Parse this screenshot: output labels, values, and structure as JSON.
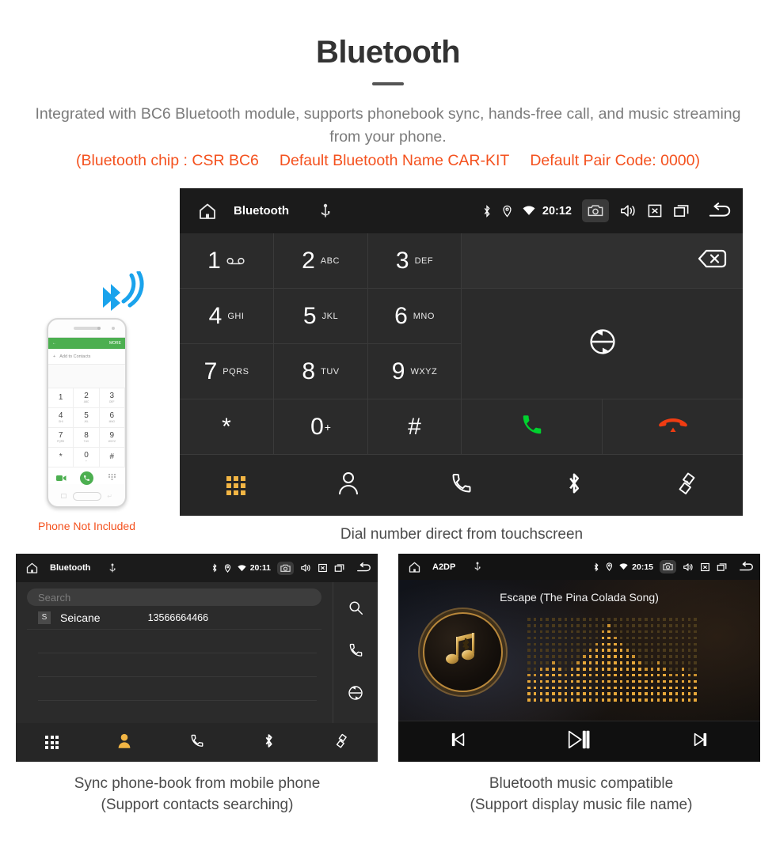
{
  "header": {
    "title": "Bluetooth",
    "subtitle": "Integrated with BC6 Bluetooth module, supports phonebook sync, hands-free call, and music streaming from your phone.",
    "spec_chip": "(Bluetooth chip : CSR BC6",
    "spec_name": "Default Bluetooth Name CAR-KIT",
    "spec_code": "Default Pair Code: 0000)",
    "accent_color": "#f4511e",
    "text_color": "#7b7b7b"
  },
  "dialer": {
    "statusbar": {
      "title": "Bluetooth",
      "time": "20:12",
      "icons_left": [
        "home-icon",
        "usb-icon"
      ],
      "icons_right": [
        "bluetooth-icon",
        "location-icon",
        "wifi-icon",
        "camera-icon",
        "volume-icon",
        "close-icon",
        "recents-icon",
        "back-icon"
      ]
    },
    "keys": [
      {
        "digit": "1",
        "sub": "∞",
        "sub_kind": "voicemail"
      },
      {
        "digit": "2",
        "sub": "ABC"
      },
      {
        "digit": "3",
        "sub": "DEF"
      },
      {
        "digit": "4",
        "sub": "GHI"
      },
      {
        "digit": "5",
        "sub": "JKL"
      },
      {
        "digit": "6",
        "sub": "MNO"
      },
      {
        "digit": "7",
        "sub": "PQRS"
      },
      {
        "digit": "8",
        "sub": "TUV"
      },
      {
        "digit": "9",
        "sub": "WXYZ"
      },
      {
        "digit": "*",
        "sub": ""
      },
      {
        "digit": "0",
        "sub": "+",
        "sub_kind": "sup"
      },
      {
        "digit": "#",
        "sub": ""
      }
    ],
    "number_display": "",
    "actions": {
      "backspace": "backspace-icon",
      "sync": "sync-icon",
      "call": "call-icon",
      "hangup": "hangup-icon",
      "call_color": "#00d12e",
      "hangup_color": "#f03c12"
    },
    "nav": [
      {
        "name": "keypad",
        "icon": "keypad-icon",
        "active": true
      },
      {
        "name": "contacts",
        "icon": "contact-icon",
        "active": false
      },
      {
        "name": "call-log",
        "icon": "phone-icon",
        "active": false
      },
      {
        "name": "bluetooth",
        "icon": "bluetooth-icon",
        "active": false
      },
      {
        "name": "link",
        "icon": "link-icon",
        "active": false
      }
    ],
    "active_color": "#f2b544"
  },
  "phonebook": {
    "statusbar": {
      "title": "Bluetooth",
      "time": "20:11"
    },
    "search_placeholder": "Search",
    "contacts": [
      {
        "initial": "S",
        "name": "Seicane",
        "number": "13566664466"
      }
    ],
    "side_actions": [
      "search-icon",
      "call-icon",
      "sync-icon"
    ],
    "nav": [
      {
        "name": "keypad",
        "icon": "keypad-icon",
        "active": false
      },
      {
        "name": "contacts",
        "icon": "contact-icon",
        "active": true
      },
      {
        "name": "call-log",
        "icon": "phone-icon",
        "active": false
      },
      {
        "name": "bluetooth",
        "icon": "bluetooth-icon",
        "active": false
      },
      {
        "name": "link",
        "icon": "link-icon",
        "active": false
      }
    ]
  },
  "music": {
    "statusbar": {
      "title": "A2DP",
      "time": "20:15"
    },
    "song_title": "Escape (The Pina Colada Song)",
    "album_icon": "music-note-bluetooth-icon",
    "controls": [
      {
        "name": "previous",
        "icon": "previous-icon"
      },
      {
        "name": "play-pause",
        "icon": "play-pause-icon"
      },
      {
        "name": "next",
        "icon": "next-icon"
      }
    ],
    "accent_color": "#e8a83a"
  },
  "phone_mock": {
    "more_label": "MORE",
    "add_contact_label": "Add to Contacts",
    "keys": [
      {
        "digit": "1",
        "sub": ""
      },
      {
        "digit": "2",
        "sub": "ABC"
      },
      {
        "digit": "3",
        "sub": "DEF"
      },
      {
        "digit": "4",
        "sub": "GHI"
      },
      {
        "digit": "5",
        "sub": "JKL"
      },
      {
        "digit": "6",
        "sub": "MNO"
      },
      {
        "digit": "7",
        "sub": "PQRS"
      },
      {
        "digit": "8",
        "sub": "TUV"
      },
      {
        "digit": "9",
        "sub": "WXYZ"
      },
      {
        "digit": "*",
        "sub": ""
      },
      {
        "digit": "0",
        "sub": "+"
      },
      {
        "digit": "#",
        "sub": ""
      }
    ],
    "note": "Phone Not Included"
  },
  "captions": {
    "dialer": "Dial number direct from touchscreen",
    "phonebook_line1": "Sync phone-book from mobile phone",
    "phonebook_line2": "(Support contacts searching)",
    "music_line1": "Bluetooth music compatible",
    "music_line2": "(Support display music file name)"
  }
}
